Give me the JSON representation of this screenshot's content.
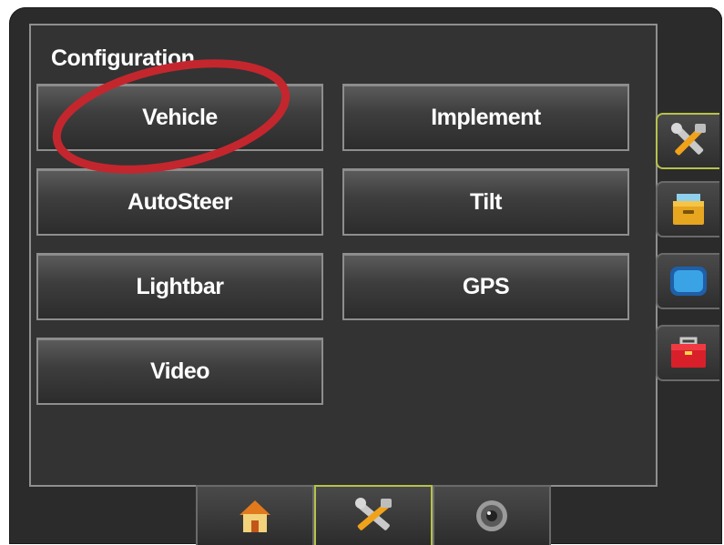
{
  "panel": {
    "title": "Configuration"
  },
  "config_buttons": {
    "vehicle": "Vehicle",
    "implement": "Implement",
    "autosteer": "AutoSteer",
    "tilt": "Tilt",
    "lightbar": "Lightbar",
    "gps": "GPS",
    "video": "Video"
  },
  "side_tabs": [
    {
      "icon": "tools-icon",
      "active": true
    },
    {
      "icon": "file-drawer-icon",
      "active": false
    },
    {
      "icon": "display-icon",
      "active": false
    },
    {
      "icon": "toolbox-icon",
      "active": false
    }
  ],
  "bottom_tabs": [
    {
      "icon": "home-icon",
      "active": false
    },
    {
      "icon": "tools-icon",
      "active": true
    },
    {
      "icon": "camera-icon",
      "active": false
    }
  ],
  "colors": {
    "highlight_ring": "#c4262e",
    "active_border": "#b7c24a"
  }
}
